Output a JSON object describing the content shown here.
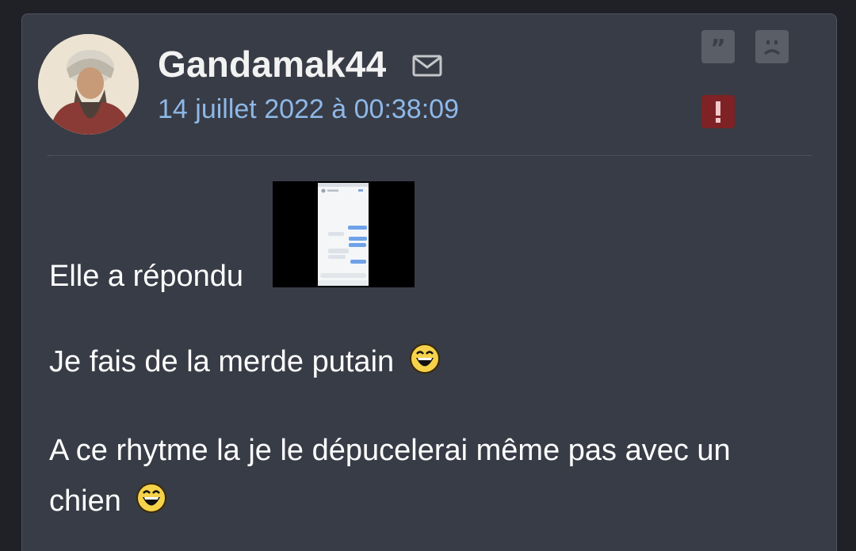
{
  "post": {
    "author": "Gandamak44",
    "date": "14 juillet 2022 à 00:38:09",
    "icons": {
      "mail": "mail-icon",
      "quote": "quote-icon",
      "sad": "sad-face-icon",
      "report": "alert-icon",
      "smiley": "laughing-smiley-icon"
    },
    "colors": {
      "background": "#383c46",
      "date": "#8eb8e8",
      "report": "#7e2225",
      "buttons": "#5a5e67"
    },
    "message": {
      "line1": "Elle a répondu",
      "line2": "Je fais de la merde putain",
      "line3": "A ce rhytme la je le dépucelerai même pas avec un chien"
    }
  }
}
